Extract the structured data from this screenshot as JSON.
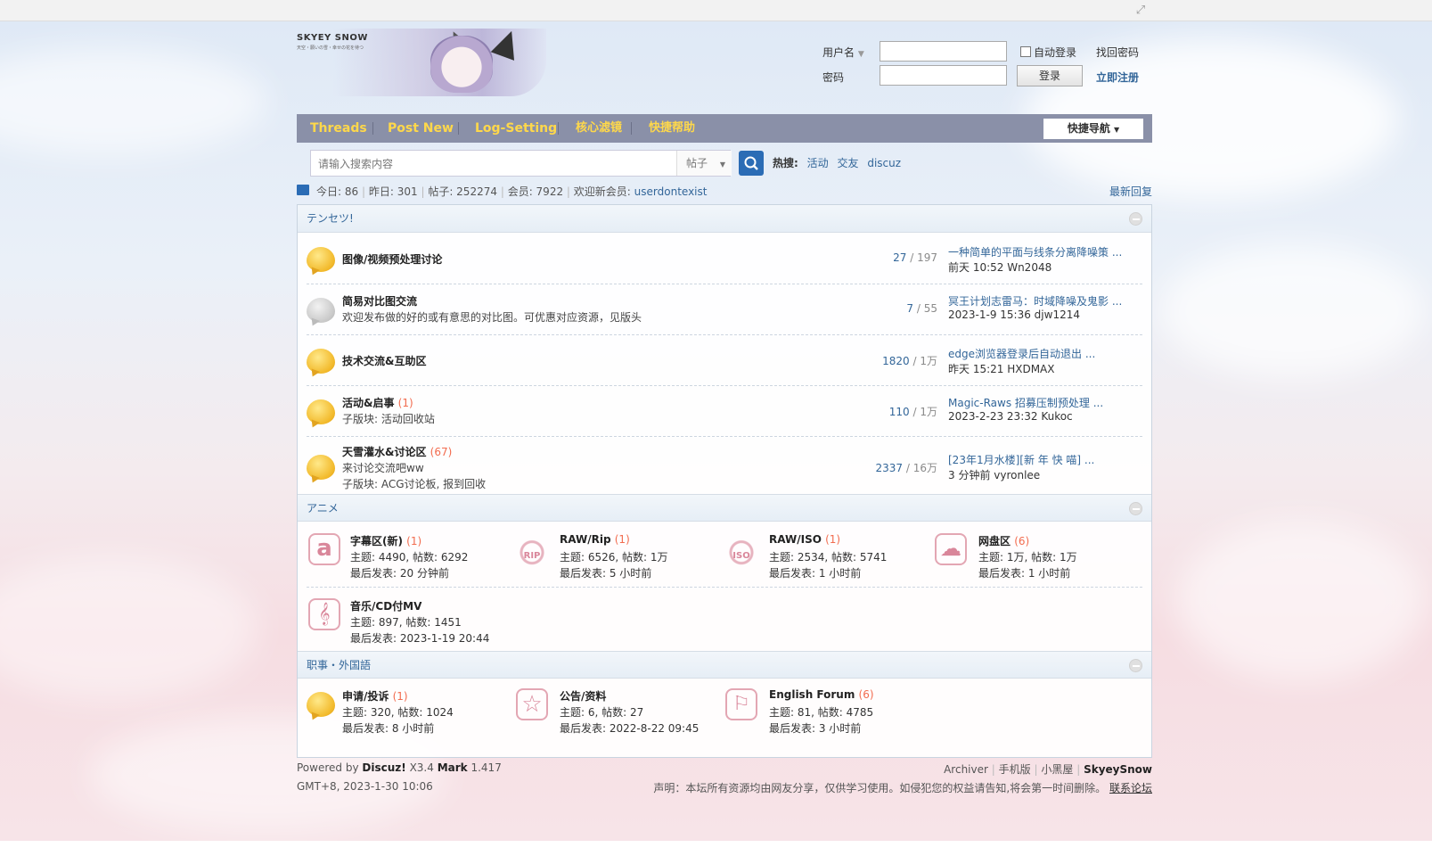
{
  "header": {
    "brand": "SKYEY SNOW",
    "brand_tag": "天空・願いの雪・幸せの花を待つ",
    "login": {
      "username_label": "用户名",
      "auto_login": "自动登录",
      "forgot": "找回密码",
      "password_label": "密码",
      "login_btn": "登录",
      "register": "立即注册"
    }
  },
  "nav": {
    "items": [
      "Threads",
      "Post New",
      "Log-Setting",
      "核心滤镜",
      "快捷帮助"
    ],
    "quick": "快捷导航"
  },
  "search": {
    "placeholder": "请输入搜索内容",
    "type": "帖子",
    "hot_label": "热搜:",
    "hot": [
      "活动",
      "交友",
      "discuz"
    ]
  },
  "stats": {
    "today": "今日: 86",
    "yesterday": "昨日: 301",
    "posts": "帖子: 252274",
    "members": "会员: 7922",
    "welcome": "欢迎新会员:",
    "newest": "userdontexist",
    "latest": "最新回复"
  },
  "cat1": {
    "title": "テンセツ!",
    "forums": [
      {
        "name": "图像/视频预处理讨论",
        "new": "",
        "desc": "",
        "sub": "",
        "threads": "27",
        "posts": "197",
        "last_title": "一种简单的平面与线条分离降噪策 ...",
        "last_meta": "前天 10:52 Wn2048",
        "icon": "gold"
      },
      {
        "name": "简易对比图交流",
        "new": "",
        "desc": "欢迎发布做的好的或有意思的对比图。可优惠对应资源，见版头",
        "sub": "",
        "threads": "7",
        "posts": "55",
        "last_title": "冥王计划志雷马：时域降噪及鬼影 ...",
        "last_meta": "2023-1-9 15:36 djw1214",
        "icon": "grey"
      },
      {
        "name": "技术交流&互助区",
        "new": "",
        "desc": "",
        "sub": "",
        "threads": "1820",
        "posts": "1万",
        "last_title": "edge浏览器登录后自动退出 ...",
        "last_meta": "昨天 15:21 HXDMAX",
        "icon": "gold"
      },
      {
        "name": "活动&启事",
        "new": "(1)",
        "desc": "子版块: 活动回收站",
        "sub": "",
        "threads": "110",
        "posts": "1万",
        "last_title": "Magic-Raws 招募压制预处理 ...",
        "last_meta": "2023-2-23 23:32 Kukoc",
        "icon": "gold"
      },
      {
        "name": "天雪灌水&讨论区",
        "new": "(67)",
        "desc": "来讨论交流吧ww",
        "sub": "子版块: ACG讨论板, 报到回收",
        "threads": "2337",
        "posts": "16万",
        "last_title": "[23年1月水楼][新 年 快 喵] ...",
        "last_meta": "3 分钟前 vyronlee",
        "icon": "gold"
      }
    ]
  },
  "cat2": {
    "title": "アニメ",
    "forums": [
      {
        "name": "字幕区(新)",
        "new": "(1)",
        "stats": "主题: 4490, 帖数: 6292",
        "last": "最后发表: 20 分钟前",
        "icon": "a-icon",
        "glyph": "a"
      },
      {
        "name": "RAW/Rip",
        "new": "(1)",
        "stats": "主题: 6526, 帖数: 1万",
        "last": "最后发表: 5 小时前",
        "icon": "rip-icon",
        "glyph": "RIP"
      },
      {
        "name": "RAW/ISO",
        "new": "(1)",
        "stats": "主题: 2534, 帖数: 5741",
        "last": "最后发表: 1 小时前",
        "icon": "iso-icon",
        "glyph": "ISO"
      },
      {
        "name": "网盘区",
        "new": "(6)",
        "stats": "主题: 1万, 帖数: 1万",
        "last": "最后发表: 1 小时前",
        "icon": "cloud-icon",
        "glyph": "☁"
      },
      {
        "name": "音乐/CD付MV",
        "new": "",
        "stats": "主题: 897, 帖数: 1451",
        "last": "最后发表: 2023-1-19 20:44",
        "icon": "music-icon",
        "glyph": "𝄞"
      }
    ]
  },
  "cat3": {
    "title": "职事・外国語",
    "forums": [
      {
        "name": "申请/投诉",
        "new": "(1)",
        "stats": "主题: 320, 帖数: 1024",
        "last": "最后发表: 8 小时前",
        "icon": "gold",
        "glyph": ""
      },
      {
        "name": "公告/资料",
        "new": "",
        "stats": "主题: 6, 帖数: 27",
        "last": "最后发表: 2022-8-22 09:45",
        "icon": "star-icon",
        "glyph": "☆"
      },
      {
        "name": "English Forum",
        "new": "(6)",
        "stats": "主题: 81, 帖数: 4785",
        "last": "最后发表: 3 小时前",
        "icon": "flag-icon",
        "glyph": "⚐"
      }
    ]
  },
  "footer": {
    "powered_pre": "Powered by",
    "discuz": "Discuz!",
    "version": "X3.4",
    "mark": "Mark",
    "mark_ver": "1.417",
    "time": "GMT+8, 2023-1-30 10:06",
    "links": [
      "Archiver",
      "手机版",
      "小黑屋"
    ],
    "site": "SkyeySnow",
    "notice": "声明：本坛所有资源均由网友分享，仅供学习使用。如侵犯您的权益请告知,将会第一时间删除。",
    "contact": "联系论坛"
  }
}
